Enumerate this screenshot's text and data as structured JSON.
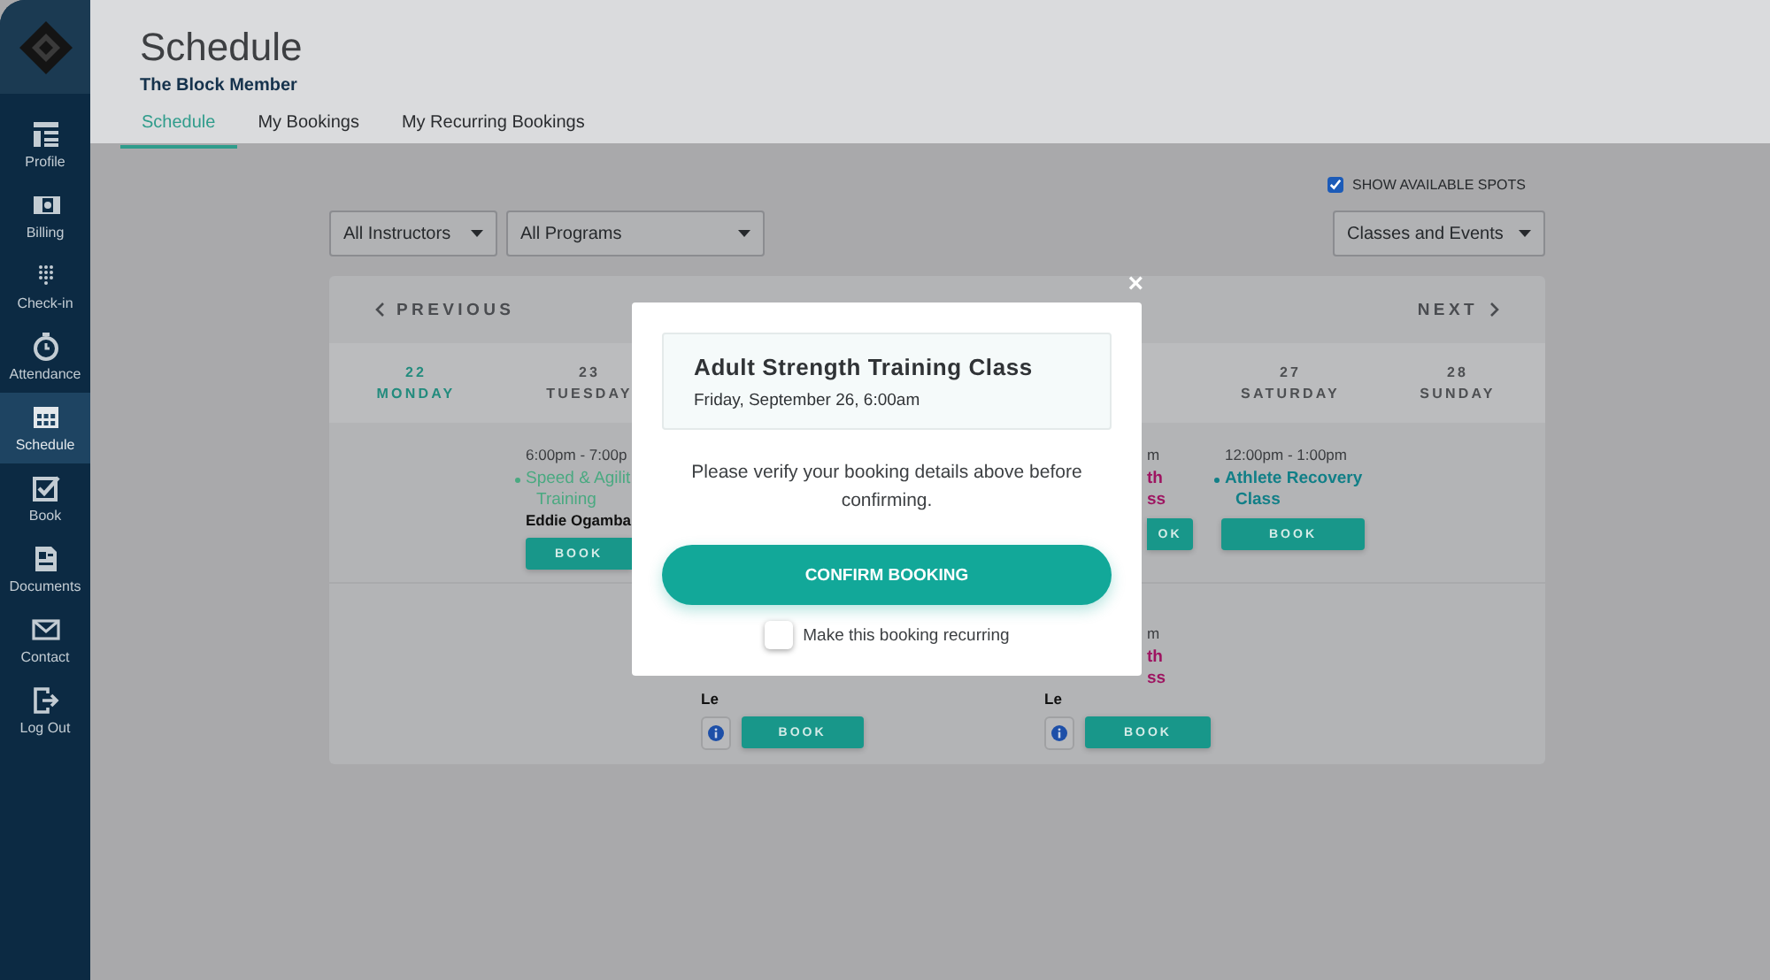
{
  "sidebar": {
    "items": [
      {
        "label": "Profile",
        "selected": false
      },
      {
        "label": "Billing",
        "selected": false
      },
      {
        "label": "Check-in",
        "selected": false
      },
      {
        "label": "Attendance",
        "selected": false
      },
      {
        "label": "Schedule",
        "selected": true
      },
      {
        "label": "Book",
        "selected": false
      },
      {
        "label": "Documents",
        "selected": false
      },
      {
        "label": "Contact",
        "selected": false
      },
      {
        "label": "Log Out",
        "selected": false
      }
    ]
  },
  "header": {
    "title": "Schedule",
    "subtitle": "The Block Member",
    "tabs": [
      {
        "label": "Schedule",
        "selected": true
      },
      {
        "label": "My Bookings",
        "selected": false
      },
      {
        "label": "My Recurring Bookings",
        "selected": false
      }
    ]
  },
  "filters": {
    "show_available_spots": {
      "label": "SHOW AVAILABLE SPOTS",
      "checked": true
    },
    "dropdowns": [
      {
        "value": "All Instructors"
      },
      {
        "value": "All Programs"
      },
      {
        "value": "Classes and Events"
      }
    ]
  },
  "calendar": {
    "previous": "PREVIOUS",
    "next": "NEXT",
    "days": [
      {
        "kind": "day",
        "date": "22",
        "name": "MONDAY",
        "selected": true
      },
      {
        "kind": "day",
        "date": "23",
        "name": "TUESDAY",
        "selected": false
      },
      {
        "kind": "hidden"
      },
      {
        "kind": "hidden"
      },
      {
        "kind": "hidden"
      },
      {
        "kind": "day",
        "date": "27",
        "name": "SATURDAY",
        "selected": false
      },
      {
        "kind": "day",
        "date": "28",
        "name": "SUNDAY",
        "selected": false
      }
    ],
    "rows": [
      {
        "cells": [
          null,
          {
            "kind": "clipped-right",
            "time": "6:00pm - 7:00p",
            "title_lines": [
              "Speed & Agilit",
              "Training"
            ],
            "color": "#4aa981",
            "instructor": "Eddie Ogamba",
            "button": {
              "label": "BOOK",
              "clipped": true
            }
          },
          null,
          null,
          {
            "kind": "clipped-left",
            "time": "m",
            "title_lines": [
              "th",
              "ss"
            ],
            "color": "#9e1461",
            "button": {
              "label": "OK",
              "clipped": true
            }
          },
          {
            "kind": "full",
            "time": "12:00pm - 1:00pm",
            "title_lines": [
              "Athlete Recovery",
              "Class"
            ],
            "color": "#117f87",
            "button": {
              "label": "BOOK",
              "clipped": false
            }
          },
          null
        ]
      },
      {
        "cells": [
          null,
          null,
          {
            "kind": "full",
            "instructor": "Le",
            "info": true,
            "button": {
              "label": "BOOK",
              "clipped": false
            }
          },
          null,
          {
            "kind": "clipped-left",
            "time": "m",
            "title_lines": [
              "th",
              "ss"
            ],
            "color": "#9e1461",
            "instructor": "Le",
            "info": true,
            "button": {
              "label": "BOOK",
              "clipped": false
            }
          },
          null,
          null
        ]
      }
    ]
  },
  "modal": {
    "class_title": "Adult Strength Training Class",
    "class_time": "Friday, September 26, 6:00am",
    "message": "Please verify your booking details above before confirming.",
    "confirm": "CONFIRM BOOKING",
    "close": "×",
    "recurring": {
      "label": "Make this booking recurring",
      "checked": false
    }
  }
}
